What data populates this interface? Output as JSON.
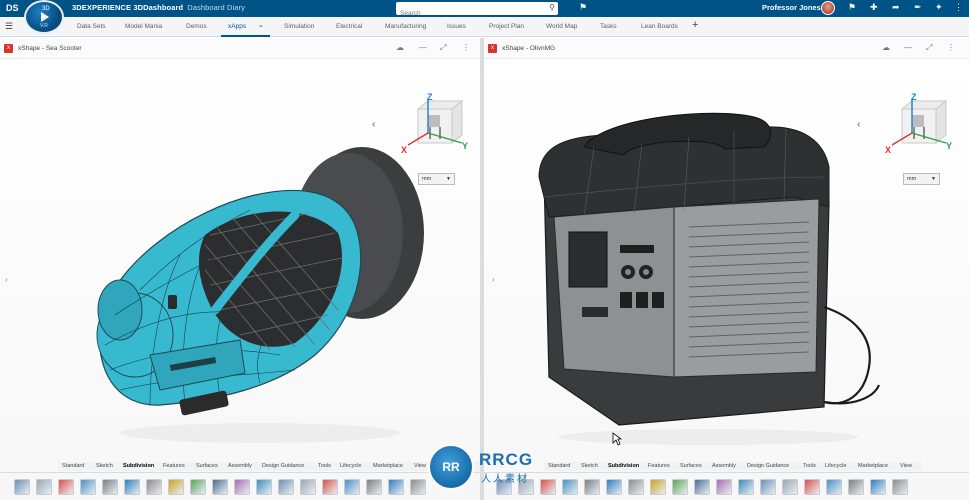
{
  "app": {
    "brand_bold": "3DEXPERIENCE 3DDashboard",
    "dashboard_name": "Dashboard Diary",
    "compass_version": "3D",
    "compass_sub": "V.R",
    "logo": "DS"
  },
  "search": {
    "placeholder": "Search"
  },
  "user": {
    "name": "Professor Jones"
  },
  "tabs": [
    {
      "label": "Data Sets"
    },
    {
      "label": "Model Mania"
    },
    {
      "label": "Demos"
    },
    {
      "label": "xApps"
    },
    {
      "label": "Simulation"
    },
    {
      "label": "Electrical"
    },
    {
      "label": "Manufacturing"
    },
    {
      "label": "Issues"
    },
    {
      "label": "Project Plan"
    },
    {
      "label": "World Map"
    },
    {
      "label": "Tasks"
    },
    {
      "label": "Lean Boards"
    }
  ],
  "active_tab": "xApps",
  "panes": {
    "left": {
      "title": "xShape - Sea Scooter",
      "unit": "mm"
    },
    "right": {
      "title": "xShape - OlivnMG",
      "unit": "mm"
    }
  },
  "toolbar_tabs": {
    "left": [
      "Standard",
      "Sketch",
      "Subdivision",
      "Features",
      "Surfaces",
      "Assembly",
      "Design Guidance",
      "Tools",
      "Lifecycle",
      "Marketplace",
      "View"
    ],
    "right": [
      "Standard",
      "Sketch",
      "Subdivision",
      "Features",
      "Surfaces",
      "Assembly",
      "Design Guidance",
      "Tools",
      "Lifecycle",
      "Marketplace",
      "View"
    ],
    "active": "Subdivision"
  },
  "watermark": {
    "title": "RRCG",
    "subtitle": "人人素材"
  },
  "colors": {
    "topbar": "#005386",
    "accent": "#005386",
    "scooter_body": "#37b9cf",
    "scooter_dark": "#3c3d3f"
  },
  "icons": {
    "search": "magnifier",
    "tag": "tag",
    "home": "house",
    "add": "plus",
    "share": "share-arrow",
    "comms": "broadcast",
    "apps": "compass-apps"
  }
}
